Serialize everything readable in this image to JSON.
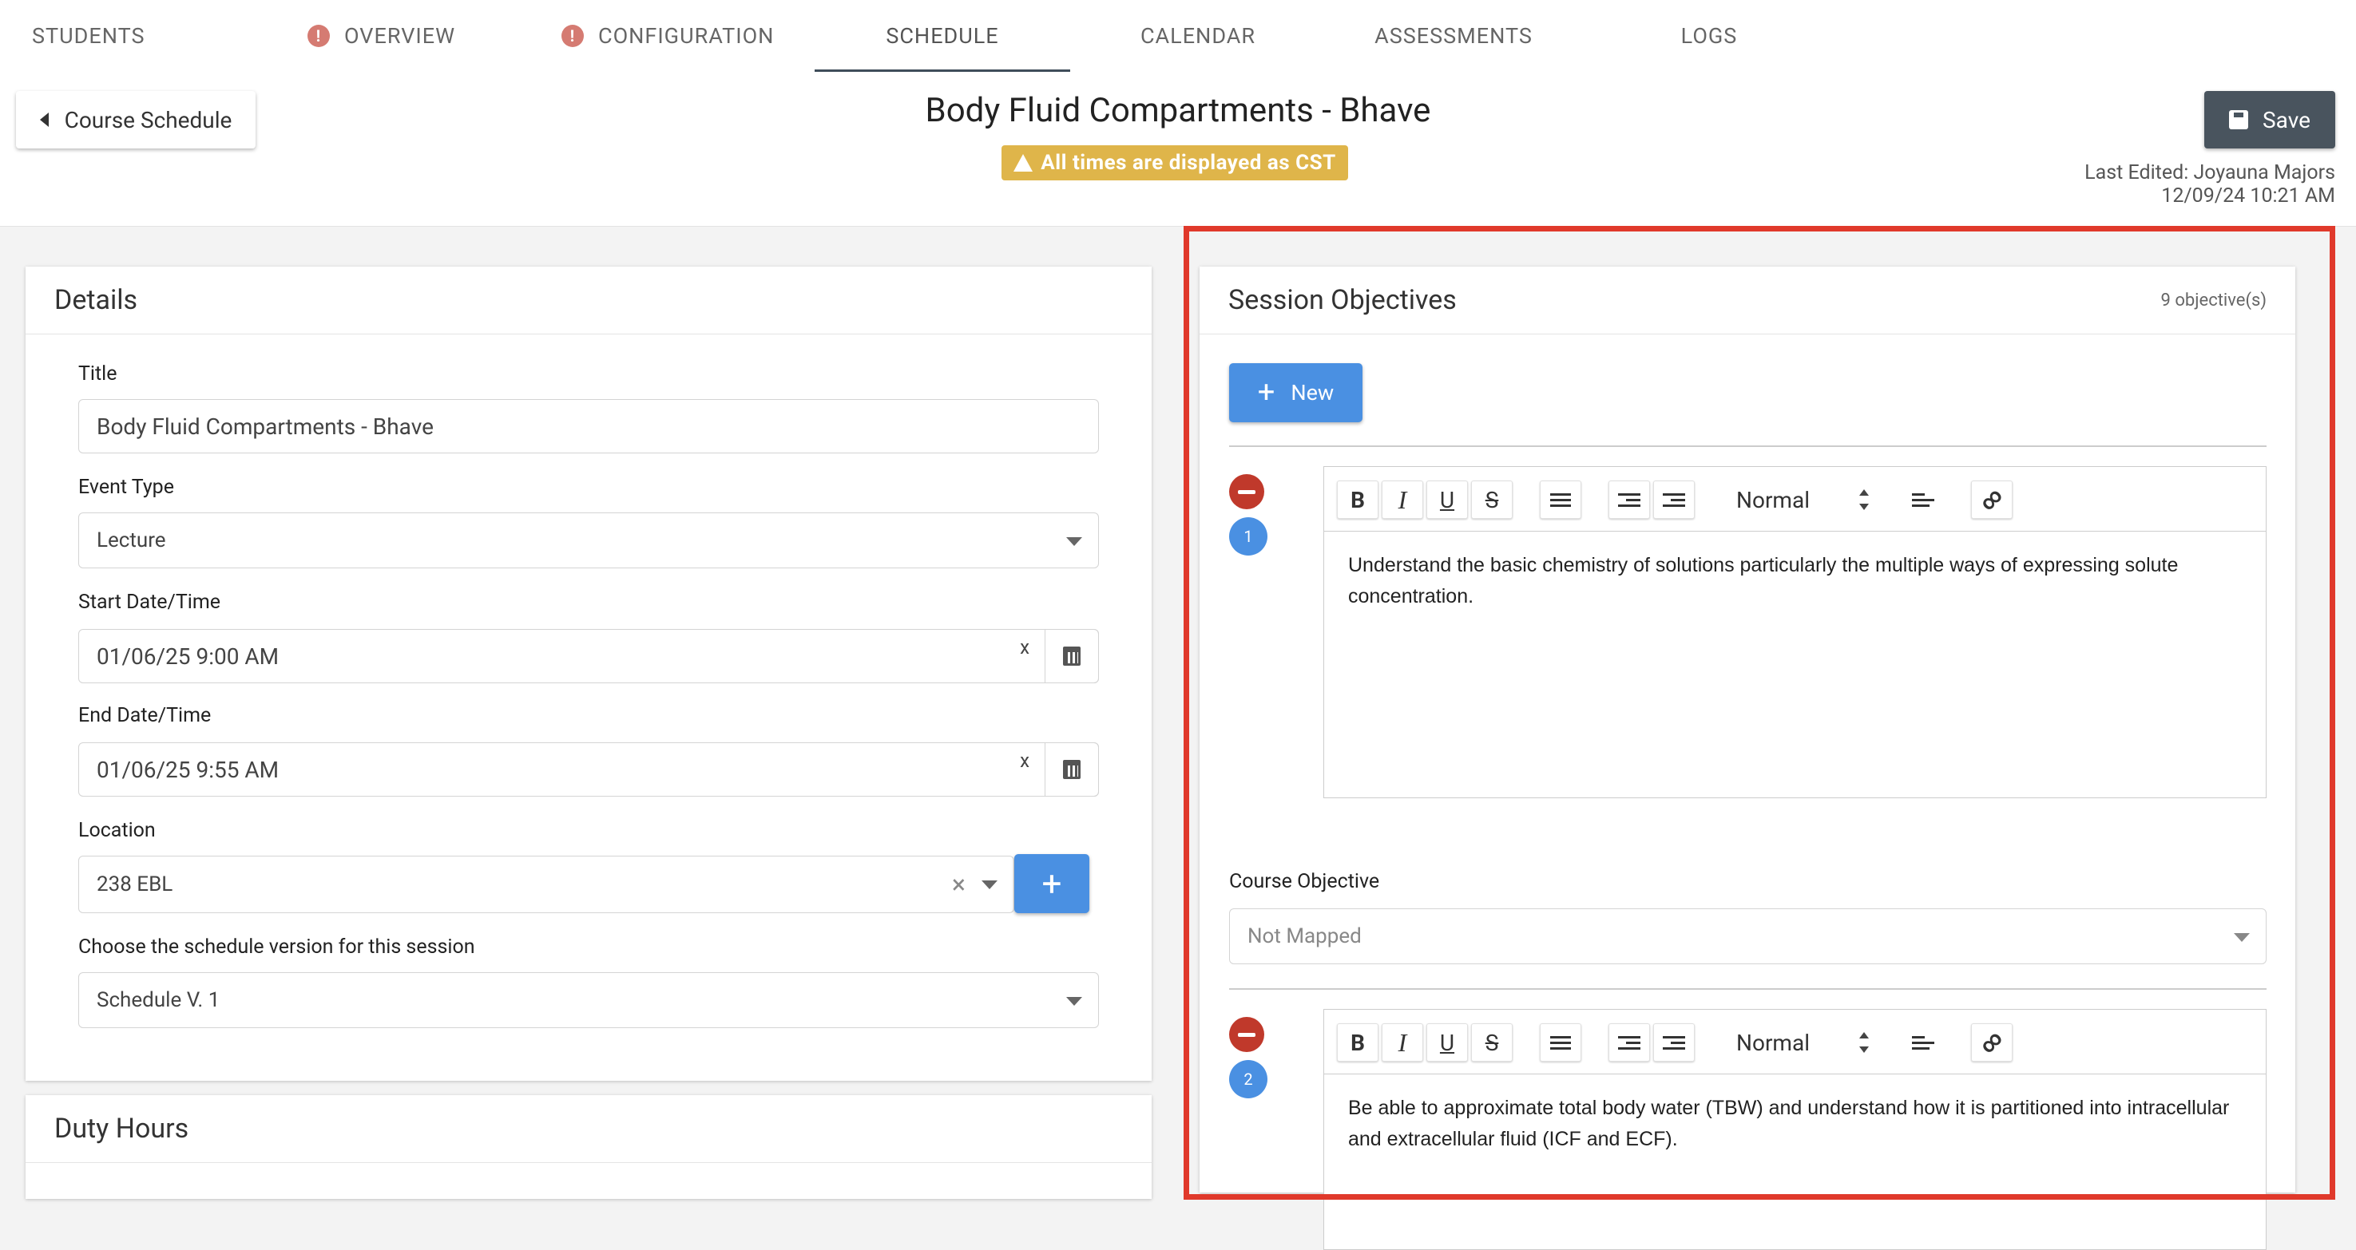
{
  "tabs": [
    {
      "label": "STUDENTS",
      "warning": false
    },
    {
      "label": "OVERVIEW",
      "warning": true
    },
    {
      "label": "CONFIGURATION",
      "warning": true
    },
    {
      "label": "SCHEDULE",
      "warning": false,
      "active": true
    },
    {
      "label": "CALENDAR",
      "warning": false
    },
    {
      "label": "ASSESSMENTS",
      "warning": false
    },
    {
      "label": "LOGS",
      "warning": false
    }
  ],
  "header": {
    "back_label": "Course Schedule",
    "title": "Body Fluid Compartments - Bhave",
    "timezone_notice": "All times are displayed as CST",
    "save_label": "Save",
    "last_edited_by": "Last Edited: Joyauna Majors",
    "last_edited_at": "12/09/24 10:21 AM"
  },
  "details": {
    "heading": "Details",
    "title_label": "Title",
    "title_value": "Body Fluid Compartments - Bhave",
    "event_type_label": "Event Type",
    "event_type_value": "Lecture",
    "start_label": "Start Date/Time",
    "start_value": "01/06/25 9:00 AM",
    "end_label": "End Date/Time",
    "end_value": "01/06/25 9:55 AM",
    "clear_glyph": "x",
    "location_label": "Location",
    "location_value": "238 EBL",
    "location_clear": "×",
    "version_label": "Choose the schedule version for this session",
    "version_value": "Schedule V. 1"
  },
  "duty_hours": {
    "heading": "Duty Hours"
  },
  "objectives": {
    "heading": "Session Objectives",
    "count": "9 objective(s)",
    "new_label": "New",
    "format_select": "Normal",
    "course_objective_label": "Course Objective",
    "course_objective_placeholder": "Not Mapped",
    "items": [
      {
        "number": "1",
        "text": "Understand the basic chemistry of solutions particularly the multiple ways of expressing solute concentration."
      },
      {
        "number": "2",
        "text": "Be able to approximate total body water (TBW) and understand how it is partitioned into intracellular and extracellular fluid (ICF and ECF)."
      }
    ]
  },
  "toolbar": {
    "bold": "B",
    "italic": "I",
    "underline": "U",
    "strike": "S"
  },
  "colors": {
    "accent": "#4a90e2",
    "warning_badge": "#dfb54a",
    "highlight": "#e0392b",
    "remove": "#c0392b",
    "save": "#49545e"
  }
}
